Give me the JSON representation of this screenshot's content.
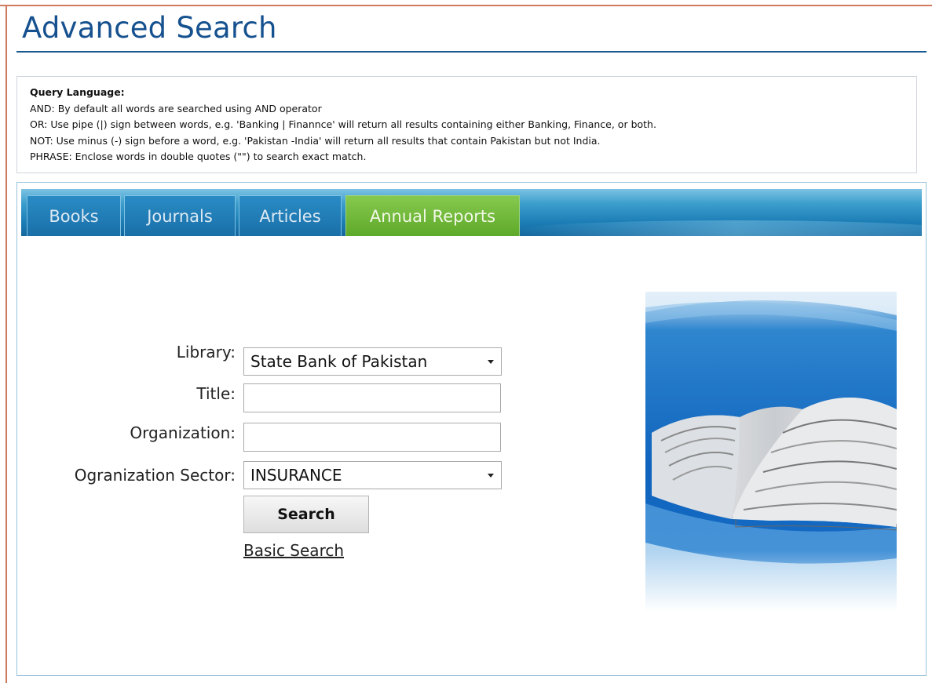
{
  "page": {
    "title": "Advanced Search"
  },
  "help": {
    "heading": "Query Language:",
    "lines": [
      "AND: By default all words are searched using AND operator",
      "OR: Use pipe (|) sign between words, e.g. 'Banking | Finannce' will return all results containing either Banking, Finance, or both.",
      "NOT: Use minus (-) sign before a word, e.g. 'Pakistan -India' will return all results that contain Pakistan but not India.",
      "PHRASE: Enclose words in double quotes (\"\") to search exact match."
    ]
  },
  "tabs": [
    {
      "label": "Books",
      "active": false
    },
    {
      "label": "Journals",
      "active": false
    },
    {
      "label": "Articles",
      "active": false
    },
    {
      "label": "Annual Reports",
      "active": true
    }
  ],
  "form": {
    "library": {
      "label": "Library:",
      "value": "State Bank of Pakistan"
    },
    "title": {
      "label": "Title:",
      "value": ""
    },
    "organization": {
      "label": "Organization:",
      "value": ""
    },
    "sector": {
      "label": "Ogranization Sector:",
      "value": "INSURANCE"
    },
    "search_button": "Search",
    "basic_search_link": "Basic Search"
  },
  "illustration": {
    "icon": "stacked-books-image"
  },
  "colors": {
    "title": "#16518f",
    "tab_bar": "#1c7eb6",
    "active_tab": "#6cb238",
    "page_border": "#cf7a5e"
  }
}
